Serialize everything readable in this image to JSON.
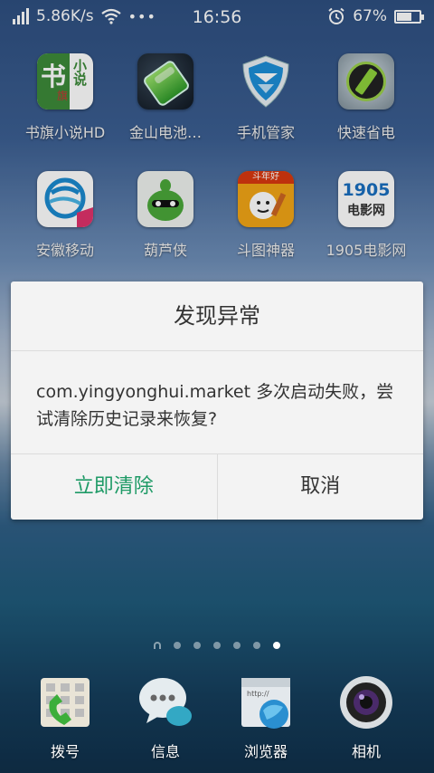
{
  "status": {
    "speed": "5.86K/s",
    "dots": "•••",
    "time": "16:56",
    "battery": "67%",
    "battery_level": 0.67
  },
  "apps": [
    {
      "label": "书旗小说HD",
      "icon": "shuqi-novel-icon"
    },
    {
      "label": "金山电池…",
      "icon": "kingsoft-battery-icon"
    },
    {
      "label": "手机管家",
      "icon": "phone-manager-icon"
    },
    {
      "label": "快速省电",
      "icon": "fast-power-save-icon"
    },
    {
      "label": "安徽移动",
      "icon": "anhui-mobile-icon"
    },
    {
      "label": "葫芦侠",
      "icon": "huluxia-icon"
    },
    {
      "label": "斗图神器",
      "icon": "doutu-icon"
    },
    {
      "label": "1905电影网",
      "icon": "movie1905-icon"
    }
  ],
  "icon_text": {
    "shuqi_1": "书",
    "shuqi_2": "小说",
    "shuqi_3": "旗",
    "movie_1": "1905",
    "movie_2": "电影网",
    "doutu": "斗年好"
  },
  "dialog": {
    "title": "发现异常",
    "message": "com.yingyonghui.market 多次启动失败，尝试清除历史记录来恢复?",
    "confirm": "立即清除",
    "cancel": "取消"
  },
  "dock": [
    {
      "label": "拨号",
      "icon": "dialer-icon"
    },
    {
      "label": "信息",
      "icon": "messages-icon"
    },
    {
      "label": "浏览器",
      "icon": "browser-icon"
    },
    {
      "label": "相机",
      "icon": "camera-icon"
    }
  ],
  "browser_url": "http://",
  "colors": {
    "accent": "#1e9a66"
  }
}
